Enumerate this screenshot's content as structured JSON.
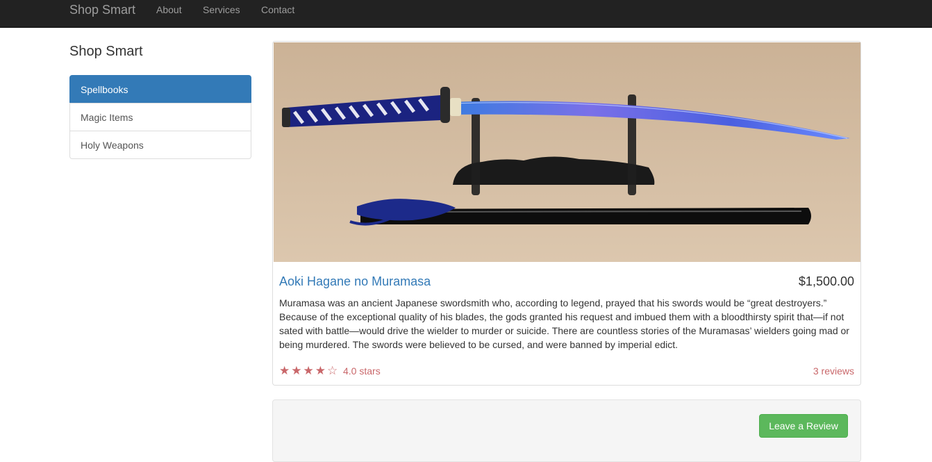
{
  "navbar": {
    "brand": "Shop Smart",
    "links": [
      "About",
      "Services",
      "Contact"
    ]
  },
  "sidebar": {
    "title": "Shop Smart",
    "items": [
      {
        "label": "Spellbooks",
        "active": true
      },
      {
        "label": "Magic Items",
        "active": false
      },
      {
        "label": "Holy Weapons",
        "active": false
      }
    ]
  },
  "product": {
    "title": "Aoki Hagane no Muramasa",
    "price": "$1,500.00",
    "description": "Muramasa was an ancient Japanese swordsmith who, according to legend, prayed that his swords would be “great destroyers.” Because of the exceptional quality of his blades, the gods granted his request and imbued them with a bloodthirsty spirit that—if not sated with battle—would drive the wielder to murder or suicide. There are countless stories of the Muramasas’ wielders going mad or being murdered. The swords were believed to be cursed, and were banned by imperial edict.",
    "stars": "★★★★☆",
    "rating_text": "4.0 stars",
    "rating_value": 4.0,
    "reviews_text": "3 reviews"
  },
  "review": {
    "button_label": "Leave a Review"
  },
  "colors": {
    "navbar_bg": "#222222",
    "active_item": "#337ab7",
    "link": "#337ab7",
    "success": "#5cb85c",
    "rating": "#c9676a"
  }
}
